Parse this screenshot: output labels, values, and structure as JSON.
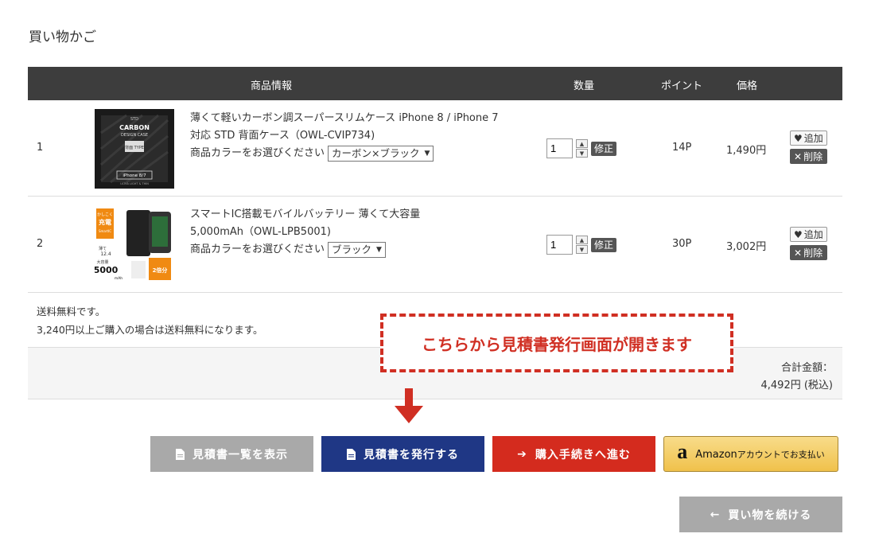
{
  "page": {
    "title": "買い物かご"
  },
  "table": {
    "headers": {
      "product": "商品情報",
      "qty": "数量",
      "points": "ポイント",
      "price": "価格"
    },
    "rows": [
      {
        "num": "1",
        "name_line1": "薄くて軽いカーボン調スーパースリムケース iPhone 8 / iPhone 7",
        "name_line2": "対応 STD 背面ケース（OWL-CVIP734)",
        "option_label": "商品カラーをお選びください",
        "option_value": "カーボン×ブラック",
        "qty": "1",
        "fix_label": "修正",
        "points": "14P",
        "price": "1,490円",
        "add_label": "追加",
        "delete_label": "削除",
        "thumb_text": {
          "brand": "STD",
          "line1": "CARBON",
          "line2": "DESIGN CASE",
          "badge": "背面 TYPE",
          "model": "iPhone 8/7",
          "foot": "ULTRA LIGHT & THIN"
        }
      },
      {
        "num": "2",
        "name_line1": "スマートIC搭載モバイルバッテリー 薄くて大容量",
        "name_line2": "5,000mAh（OWL-LPB5001)",
        "option_label": "商品カラーをお選びください",
        "option_value": "ブラック",
        "qty": "1",
        "fix_label": "修正",
        "points": "30P",
        "price": "3,002円",
        "add_label": "追加",
        "delete_label": "削除",
        "thumb_text": {
          "tag1": "かしこく",
          "tag2": "充電",
          "tag3": "SmartIC",
          "thin": "薄て",
          "thickness": "12.4",
          "cap_label": "大容量",
          "capacity": "5000",
          "unit": "mAh",
          "charge": "2倍分"
        }
      }
    ]
  },
  "shipping": {
    "line1": "送料無料です。",
    "line2": "3,240円以上ご購入の場合は送料無料になります。"
  },
  "total": {
    "label": "合計金額：",
    "value": "4,492円 (税込)"
  },
  "callout": {
    "text": "こちらから見積書発行画面が開きます"
  },
  "buttons": {
    "estimate_list": "見積書一覧を表示",
    "estimate_issue": "見積書を発行する",
    "checkout": "購入手続きへ進む",
    "amazon_brand": "Amazon",
    "amazon_rest": "アカウントでお支払い",
    "amazon_logo": "a",
    "continue": "買い物を続ける"
  },
  "colors": {
    "header_bg": "#3d3d3d",
    "issue_button": "#1f3785",
    "checkout_button": "#d42b1e",
    "callout_red": "#d02f23",
    "gray_button": "#a9a9a9",
    "amazon_gold": "#f0c14b"
  }
}
